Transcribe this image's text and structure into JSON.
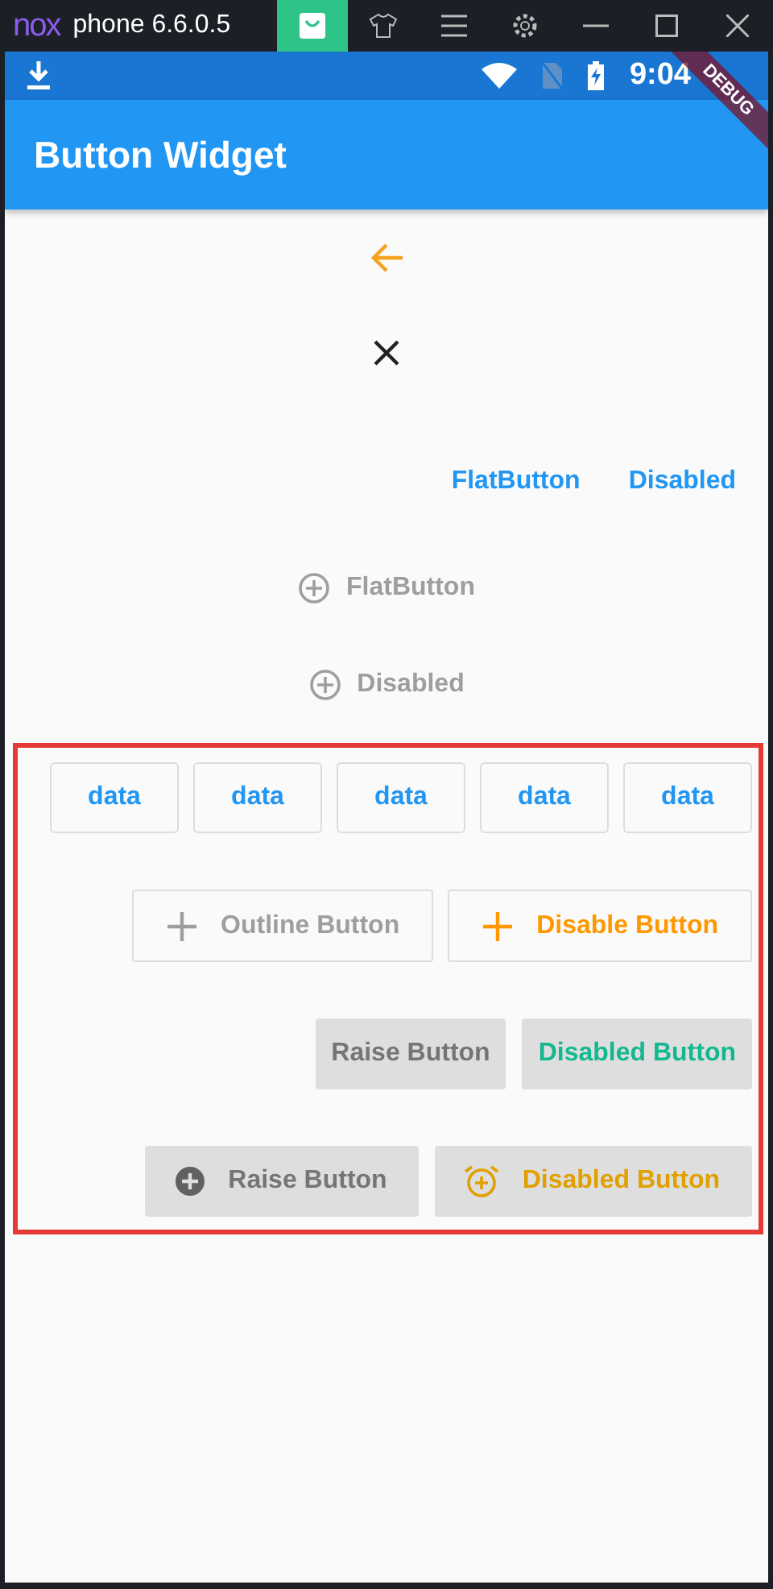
{
  "emulator": {
    "logo": "nox",
    "title": "phone 6.6.0.5",
    "tools": [
      {
        "kind": "store",
        "selected": true
      },
      {
        "kind": "shirt",
        "selected": false
      },
      {
        "kind": "menu",
        "selected": false
      },
      {
        "kind": "settings",
        "selected": false
      },
      {
        "kind": "minimize",
        "selected": false
      },
      {
        "kind": "maximize",
        "selected": false
      },
      {
        "kind": "close",
        "selected": false
      }
    ]
  },
  "status_bar": {
    "time": "9:04"
  },
  "debug_banner": "DEBUG",
  "app_bar": {
    "title": "Button Widget"
  },
  "icon_buttons": [
    {
      "kind": "back",
      "color": "#f5a11c"
    },
    {
      "kind": "close",
      "color": "#222222"
    }
  ],
  "flat_buttons": [
    {
      "label": "FlatButton"
    },
    {
      "label": "Disabled"
    }
  ],
  "icon_flat_buttons": [
    {
      "label": "FlatButton"
    },
    {
      "label": "Disabled"
    }
  ],
  "data_buttons": [
    "data",
    "data",
    "data",
    "data",
    "data"
  ],
  "outline_buttons": [
    {
      "label": "Outline Button",
      "color": "#9e9e9e"
    },
    {
      "label": "Disable Button",
      "color": "#ff9800"
    }
  ],
  "raised_buttons": [
    {
      "label": "Raise Button",
      "color": "#757575"
    },
    {
      "label": "Disabled Button",
      "color": "#14b890"
    }
  ],
  "icon_raised_buttons": [
    {
      "label": "Raise Button",
      "kind": "add-circle",
      "color": "#757575"
    },
    {
      "label": "Disabled Button",
      "kind": "alarm-add",
      "color": "#e0a000"
    }
  ]
}
